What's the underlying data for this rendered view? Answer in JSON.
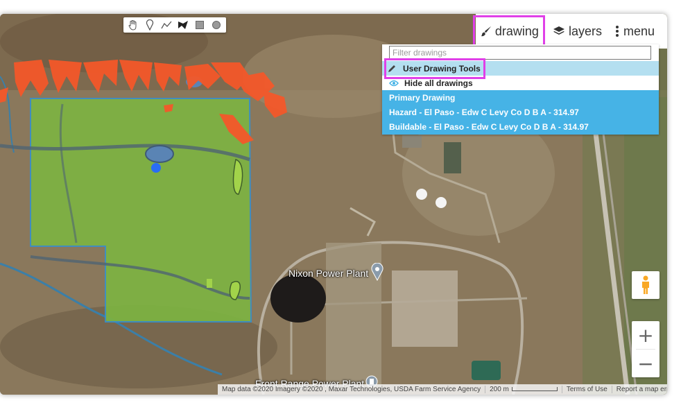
{
  "toolbar": {
    "tools": [
      "hand-icon",
      "marker-icon",
      "polyline-icon",
      "polygon-icon",
      "rectangle-icon",
      "circle-icon"
    ]
  },
  "top_controls": {
    "drawing_label": "drawing",
    "layers_label": "layers",
    "menu_label": "menu"
  },
  "dropdown": {
    "filter_placeholder": "Filter drawings",
    "user_tools_label": "User Drawing Tools",
    "hide_all_label": "Hide all drawings",
    "items": [
      "Primary Drawing",
      "Hazard - El Paso - Edw C Levy Co D B A - 314.97",
      "Buildable - El Paso - Edw C Levy Co D B A - 314.97"
    ]
  },
  "map_labels": {
    "place_1": "Nixon Power Plant",
    "place_2": "Front Range Power Plant"
  },
  "zoom": {
    "in_label": "+",
    "out_label": "−"
  },
  "attribution": {
    "data": "Map data ©2020 Imagery ©2020 , Maxar Technologies, USDA Farm Service Agency",
    "scale": "200 m",
    "terms": "Terms of Use",
    "report": "Report a map error"
  },
  "colors": {
    "highlight": "#e040e8",
    "buildable": "#7cb342",
    "hazard": "#f4511e",
    "selected_row": "#b4dff0",
    "list_blue": "#46b3e6"
  }
}
